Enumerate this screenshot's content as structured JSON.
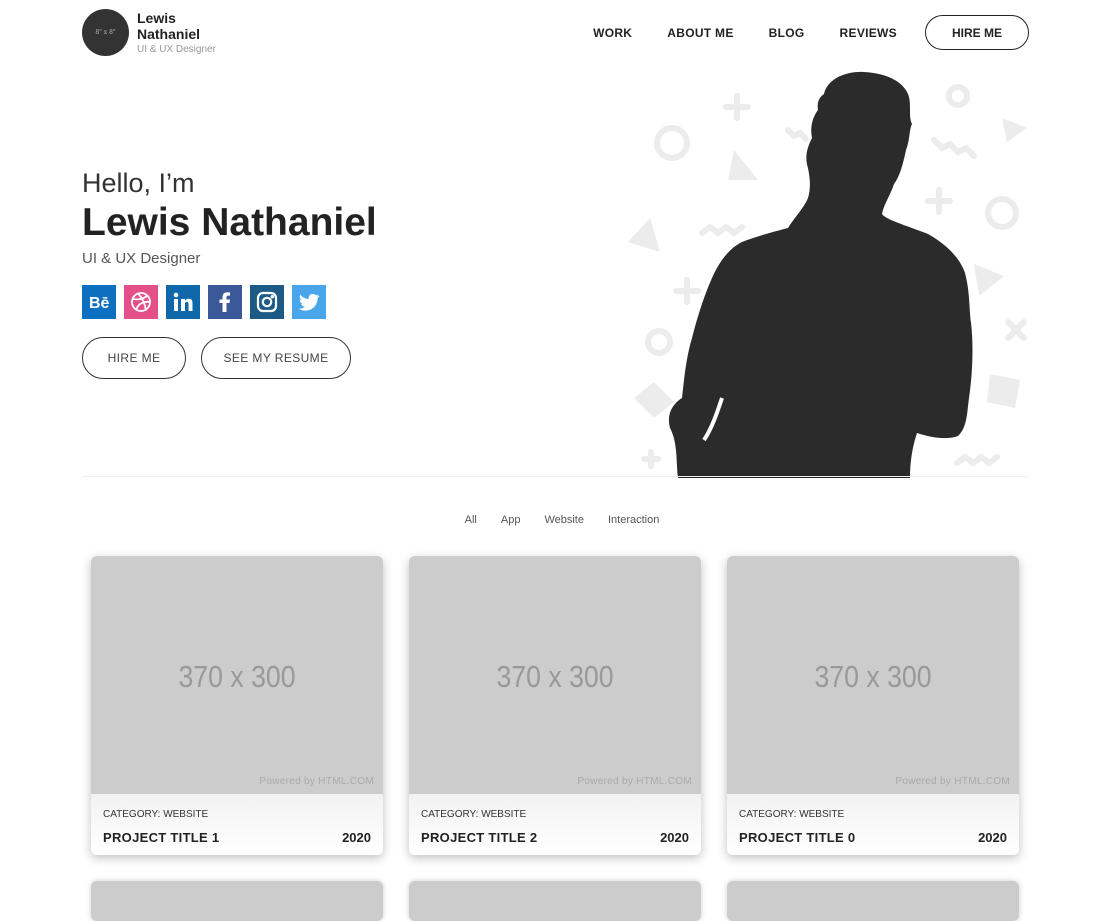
{
  "header": {
    "logo_badge": "8\" x 8\"",
    "name": "Lewis Nathaniel",
    "role": "UI & UX Designer",
    "nav": [
      "WORK",
      "ABOUT ME",
      "BLOG",
      "REVIEWS"
    ],
    "hire_label": "HIRE ME"
  },
  "hero": {
    "greeting": "Hello, I’m",
    "name": "Lewis Nathaniel",
    "role": "UI & UX Designer",
    "socials": [
      {
        "name": "behance-icon",
        "color": "#0d6fbf"
      },
      {
        "name": "dribbble-icon",
        "color": "#e4508a"
      },
      {
        "name": "linkedin-icon",
        "color": "#0e67a8"
      },
      {
        "name": "facebook-icon",
        "color": "#3b5998"
      },
      {
        "name": "instagram-icon",
        "color": "#1d5b86"
      },
      {
        "name": "twitter-icon",
        "color": "#4aa6ea"
      }
    ],
    "hire_button": "HIRE ME",
    "resume_button": "SEE MY RESUME"
  },
  "filters": [
    "All",
    "App",
    "Website",
    "Interaction"
  ],
  "projects": [
    {
      "thumb": "370 x 300",
      "powered": "Powered by HTML.COM",
      "category": "CATEGORY: WEBSITE",
      "title": "PROJECT TITLE 1",
      "year": "2020"
    },
    {
      "thumb": "370 x 300",
      "powered": "Powered by HTML.COM",
      "category": "CATEGORY: WEBSITE",
      "title": "PROJECT TITLE 2",
      "year": "2020"
    },
    {
      "thumb": "370 x 300",
      "powered": "Powered by HTML.COM",
      "category": "CATEGORY: WEBSITE",
      "title": "PROJECT TITLE 0",
      "year": "2020"
    }
  ]
}
